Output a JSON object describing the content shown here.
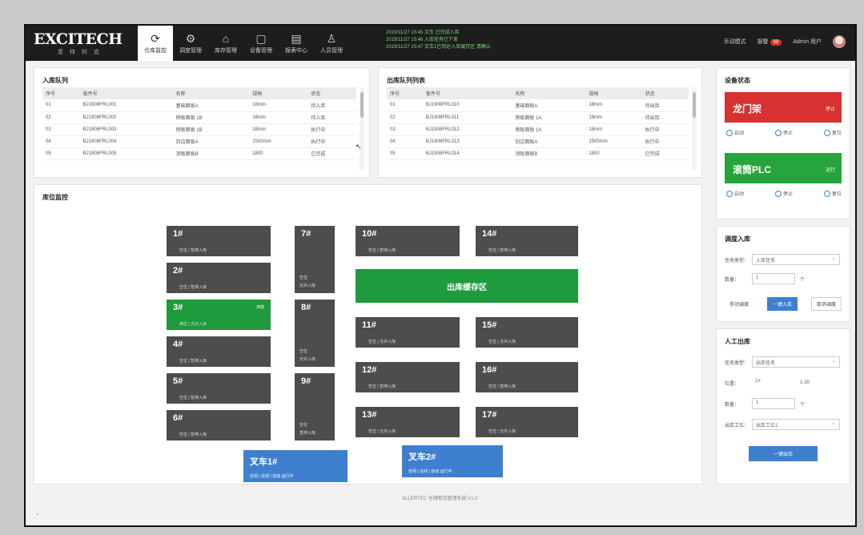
{
  "header": {
    "brand": "EXCITECH",
    "brand_sub": "意 特 利 克",
    "tabs": [
      {
        "label": "仓库监控",
        "icon": "refresh-icon"
      },
      {
        "label": "调度管理",
        "icon": "dispatch-icon"
      },
      {
        "label": "库存管理",
        "icon": "inventory-icon"
      },
      {
        "label": "设备管理",
        "icon": "device-icon"
      },
      {
        "label": "报表中心",
        "icon": "report-icon"
      },
      {
        "label": "人员管理",
        "icon": "user-icon"
      }
    ],
    "ticker": [
      "2019/11/27 15:45 叉车 已完成入库",
      "2019/11/27 15:46 入库任务已下发",
      "2019/11/27 15:47 叉车1已到达入库缓存区 请确认"
    ],
    "user": {
      "mode": "手动模式",
      "alerts": "报警",
      "alert_count": "99",
      "name": "Admin 用户"
    }
  },
  "inbound_tasks": {
    "title": "入库队列",
    "columns": [
      "序号",
      "板件号",
      "名称",
      "规格",
      "状态"
    ],
    "rows": [
      [
        "01",
        "BJ1908FRL001",
        "基础面板A",
        "18mm",
        "待入库"
      ],
      [
        "02",
        "BJ1908FRL002",
        "侧板面板 1B",
        "18mm",
        "待入库"
      ],
      [
        "03",
        "BJ1908FRL003",
        "侧板面板 1B",
        "18mm",
        "执行中"
      ],
      [
        "04",
        "BJ1908FRL004",
        "封边面板A",
        "1500mm",
        "执行中"
      ],
      [
        "05",
        "BJ1908FRL005",
        "顶板面板B",
        "1800",
        "已完成"
      ]
    ]
  },
  "outbound_tasks": {
    "title": "出库队列列表",
    "columns": [
      "序号",
      "板件号",
      "名称",
      "规格",
      "状态"
    ],
    "rows": [
      [
        "01",
        "BJ1908FRL010",
        "基础面板A",
        "18mm",
        "待出库"
      ],
      [
        "02",
        "BJ1908FRL011",
        "侧板面板 1A",
        "18mm",
        "待出库"
      ],
      [
        "03",
        "BJ1908FRL012",
        "侧板面板 1A",
        "18mm",
        "执行中"
      ],
      [
        "04",
        "BJ1908FRL013",
        "封边面板A",
        "1500mm",
        "执行中"
      ],
      [
        "05",
        "BJ1908FRL014",
        "顶板面板B",
        "1800",
        "已完成"
      ]
    ]
  },
  "monitor": {
    "title": "库位监控",
    "bays": [
      {
        "num": "1#",
        "info": "空位    |    暂停入库"
      },
      {
        "num": "2#",
        "info": "空位    |    暂停入库"
      },
      {
        "num": "3#",
        "info": "满位    |    允许入库",
        "extra": "满载"
      },
      {
        "num": "4#",
        "info": "空位    |    暂停入库"
      },
      {
        "num": "5#",
        "info": "空位    |    暂停入库"
      },
      {
        "num": "6#",
        "info": "空位    |    暂停入库"
      },
      {
        "num": "7#",
        "info": "允许入库",
        "info2": "空位"
      },
      {
        "num": "8#",
        "info": "允许入库",
        "info2": "空位"
      },
      {
        "num": "9#",
        "info": "暂停入库",
        "info2": "空位"
      },
      {
        "num": "10#",
        "info": "空位    |    暂停入库"
      },
      {
        "num": "11#",
        "info": "空位    |    允许入库"
      },
      {
        "num": "12#",
        "info": "空位    |    暂停入库"
      },
      {
        "num": "13#",
        "info": "空位    |    允许入库"
      },
      {
        "num": "14#",
        "info": "空位    |    暂停入库"
      },
      {
        "num": "15#",
        "info": "空位    |    允许入库"
      },
      {
        "num": "16#",
        "info": "空位    |    暂停入库"
      },
      {
        "num": "17#",
        "info": "空位    |    允许入库"
      }
    ],
    "outlet_label": "出库缓存区",
    "forklifts": [
      {
        "num": "叉车1#",
        "info": "空闲 | 在线    |    自动 运行中"
      },
      {
        "num": "叉车2#",
        "info": "空闲 | 在线    |    自动 运行中"
      }
    ],
    "footer": "ALLERTEC 仓储物流管理系统 V1.0"
  },
  "side": {
    "equipment": {
      "title": "设备状态",
      "cards": [
        {
          "label": "龙门架",
          "state": "停止",
          "color": "#d73131"
        },
        {
          "label": "滚筒PLC",
          "state": "运行",
          "color": "#27a43d"
        }
      ],
      "actions": [
        "启动",
        "停止",
        "复位"
      ]
    },
    "inbound_form": {
      "title": "调度入库",
      "fields": [
        {
          "label": "任务类型：",
          "value": "入库任务"
        },
        {
          "label": "数量：",
          "value": "1",
          "unit": "个"
        }
      ],
      "buttons": [
        "手动调度",
        "一键入库",
        "取消调度"
      ]
    },
    "manual_form": {
      "title": "人工出库",
      "fields": [
        {
          "label": "任务类型：",
          "value": "出库任务"
        },
        {
          "label": "位置：",
          "value": "1#",
          "unit": "1-20"
        },
        {
          "label": "数量：",
          "value": "1",
          "unit": "个"
        },
        {
          "label": "出库工位：",
          "value": "出库工位1"
        }
      ],
      "submit": "一键出库"
    }
  }
}
